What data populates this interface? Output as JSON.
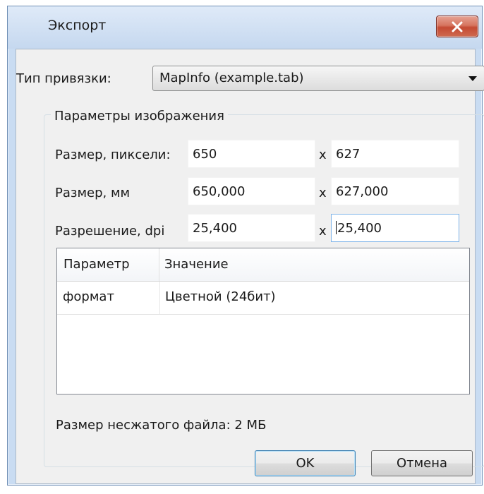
{
  "dialog": {
    "title": "Экспорт",
    "close_icon": "close-icon"
  },
  "binding": {
    "label": "Тип привязки:",
    "selected": "MapInfo (example.tab)"
  },
  "image_params": {
    "group_title": "Параметры изображения",
    "size_px": {
      "label": "Размер, пиксели:",
      "width": "650",
      "x": "x",
      "height": "627"
    },
    "size_mm": {
      "label": "Размер, мм",
      "width": "650,000",
      "x": "x",
      "height": "627,000"
    },
    "resolution": {
      "label": "Разрешение, dpi",
      "horizontal": "25,400",
      "x": "x",
      "vertical": "25,400"
    }
  },
  "table": {
    "columns": [
      "Параметр",
      "Значение"
    ],
    "rows": [
      {
        "param": "формат",
        "value": "Цветной (24бит)"
      }
    ]
  },
  "file_size_text": "Размер несжатого файла: 2 МБ",
  "buttons": {
    "ok": "OK",
    "cancel": "Отмена"
  }
}
